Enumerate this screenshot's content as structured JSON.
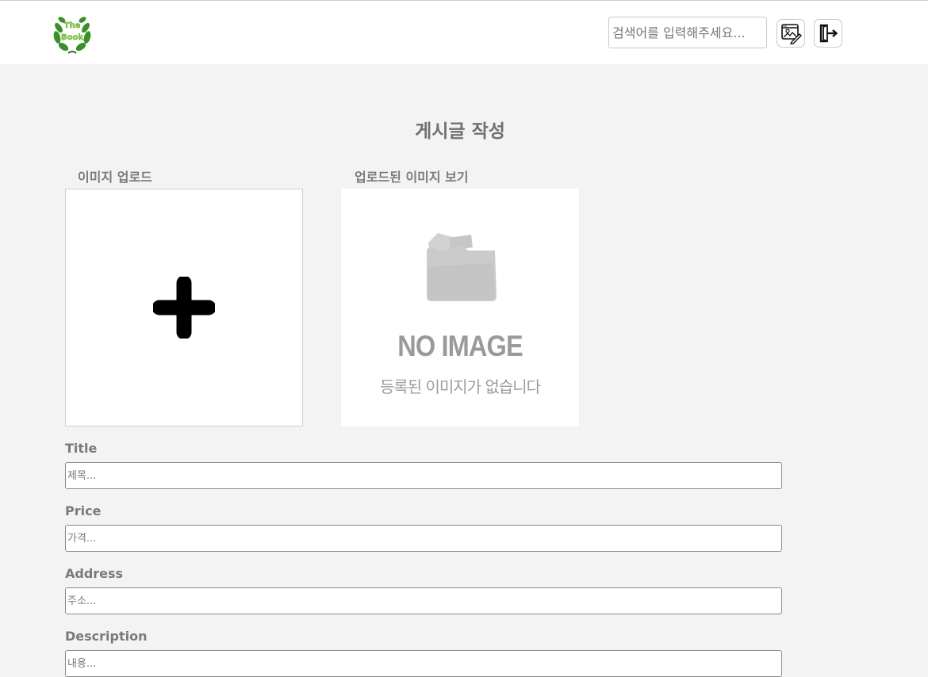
{
  "header": {
    "logo_text": [
      "The",
      "Book"
    ],
    "search_placeholder": "검색어를 입력해주세요...",
    "write_icon": "edit-image-icon",
    "logout_icon": "logout-icon"
  },
  "page": {
    "title": "게시글 작성"
  },
  "upload": {
    "label": "이미지 업로드",
    "add_icon": "plus-icon"
  },
  "preview": {
    "label": "업로드된 이미지 보기",
    "no_image_title": "NO IMAGE",
    "no_image_subtitle": "등록된 이미지가 없습니다",
    "folder_icon": "folder-icon"
  },
  "form": {
    "title": {
      "label": "Title",
      "placeholder": "제목..."
    },
    "price": {
      "label": "Price",
      "placeholder": "가격..."
    },
    "address": {
      "label": "Address",
      "placeholder": "주소..."
    },
    "description": {
      "label": "Description",
      "placeholder": "내용..."
    }
  },
  "colors": {
    "page_bg": "#f3f3f3",
    "header_bg": "#ffffff",
    "text_gray": "#777777",
    "logo_leaf": "#3a8f2a",
    "logo_text": "#8be04a"
  }
}
